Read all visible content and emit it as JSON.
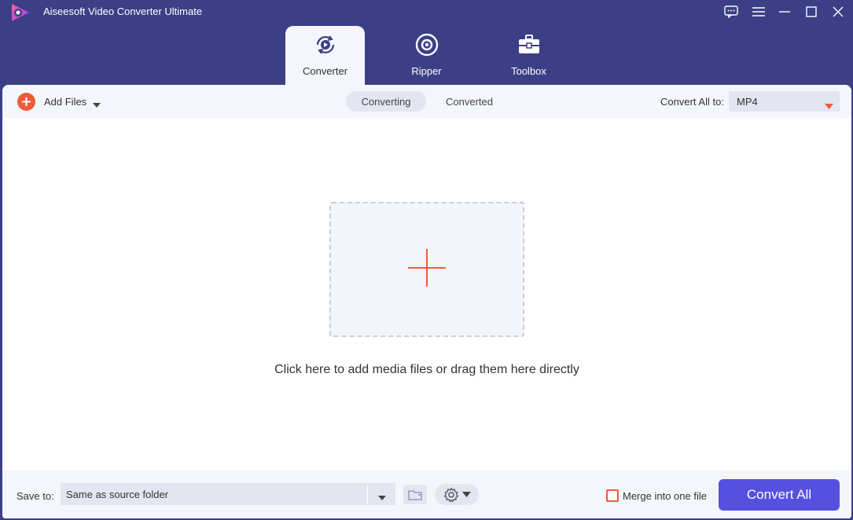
{
  "app": {
    "title": "Aiseesoft Video Converter Ultimate"
  },
  "window_controls": [
    "feedback-icon",
    "menu-icon",
    "minimize-icon",
    "maximize-icon",
    "close-icon"
  ],
  "tabs": [
    {
      "label": "Converter",
      "icon": "converter-icon",
      "active": true
    },
    {
      "label": "Ripper",
      "icon": "ripper-disc-icon",
      "active": false
    },
    {
      "label": "Toolbox",
      "icon": "toolbox-icon",
      "active": false
    }
  ],
  "toolbar": {
    "add_files_label": "Add Files",
    "segments": [
      {
        "label": "Converting",
        "active": true
      },
      {
        "label": "Converted",
        "active": false
      }
    ],
    "convert_all_to_label": "Convert All to:",
    "format_value": "MP4"
  },
  "drop_zone": {
    "hint": "Click here to add media files or drag them here directly"
  },
  "bottom": {
    "save_to_label": "Save to:",
    "save_path": "Same as source folder",
    "merge_label": "Merge into one file",
    "merge_checked": false,
    "convert_all_button": "Convert All"
  },
  "colors": {
    "header_bg": "#3b3f86",
    "accent_orange": "#ef5a3a",
    "primary_button": "#5551e0",
    "panel_bg": "#f4f6fb"
  }
}
